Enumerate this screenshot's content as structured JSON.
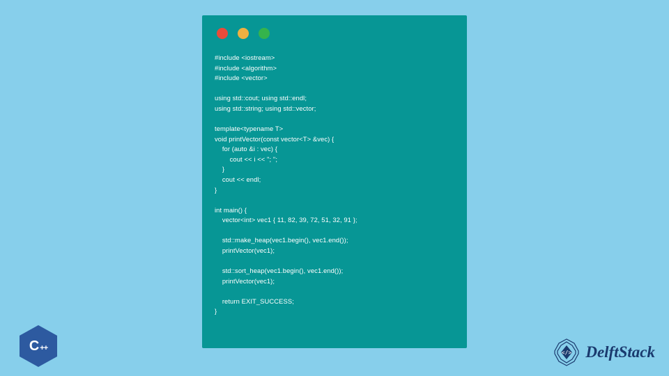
{
  "code_window": {
    "traffic_lights": [
      "red",
      "yellow",
      "green"
    ],
    "code": "#include <iostream>\n#include <algorithm>\n#include <vector>\n\nusing std::cout; using std::endl;\nusing std::string; using std::vector;\n\ntemplate<typename T>\nvoid printVector(const vector<T> &vec) {\n    for (auto &i : vec) {\n        cout << i << \"; \";\n    }\n    cout << endl;\n}\n\nint main() {\n    vector<int> vec1 { 11, 82, 39, 72, 51, 32, 91 };\n\n    std::make_heap(vec1.begin(), vec1.end());\n    printVector(vec1);\n\n    std::sort_heap(vec1.begin(), vec1.end());\n    printVector(vec1);\n\n    return EXIT_SUCCESS;\n}"
  },
  "badges": {
    "cpp_label_c": "C",
    "cpp_label_plus": "++",
    "delft_text": "DelftStack"
  },
  "colors": {
    "page_bg": "#87cfeb",
    "window_bg": "#079695",
    "dot_red": "#e84b3a",
    "dot_yellow": "#efb041",
    "dot_green": "#35b44c",
    "cpp_hex": "#2d5aa0",
    "delft_blue": "#1a3a6e"
  }
}
